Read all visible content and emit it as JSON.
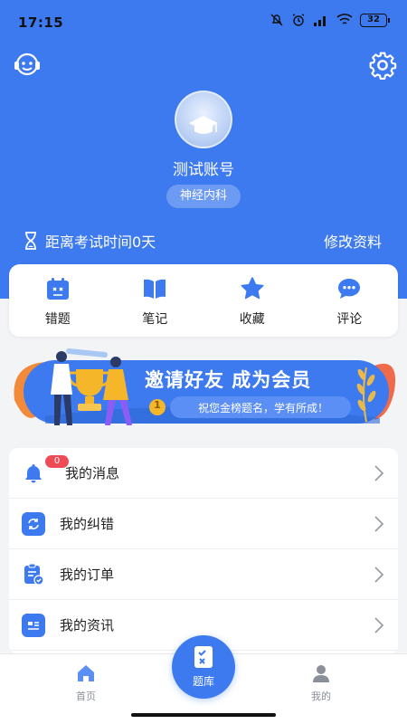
{
  "status_bar": {
    "time": "17:15",
    "battery": "32"
  },
  "profile": {
    "username": "测试账号",
    "department": "神经内科"
  },
  "countdown": {
    "label": "距离考试时间0天"
  },
  "edit_profile": "修改资料",
  "quick_actions": [
    {
      "label": "错题",
      "icon": "calendar-x-icon"
    },
    {
      "label": "笔记",
      "icon": "book-icon"
    },
    {
      "label": "收藏",
      "icon": "star-icon"
    },
    {
      "label": "评论",
      "icon": "chat-bubble-icon"
    }
  ],
  "banner": {
    "title": "邀请好友 成为会员",
    "subtitle": "祝您金榜题名，学有所成！",
    "rank": "1"
  },
  "menu": [
    {
      "label": "我的消息",
      "icon": "bell-icon",
      "badge": "0"
    },
    {
      "label": "我的纠错",
      "icon": "correction-icon"
    },
    {
      "label": "我的订单",
      "icon": "order-icon"
    },
    {
      "label": "我的资讯",
      "icon": "news-icon"
    }
  ],
  "tabbar": {
    "home": "首页",
    "center": "题库",
    "mine": "我的"
  },
  "colors": {
    "primary": "#3d7af0",
    "badge": "#ef4b57",
    "banner_gold": "#f5b62a"
  }
}
